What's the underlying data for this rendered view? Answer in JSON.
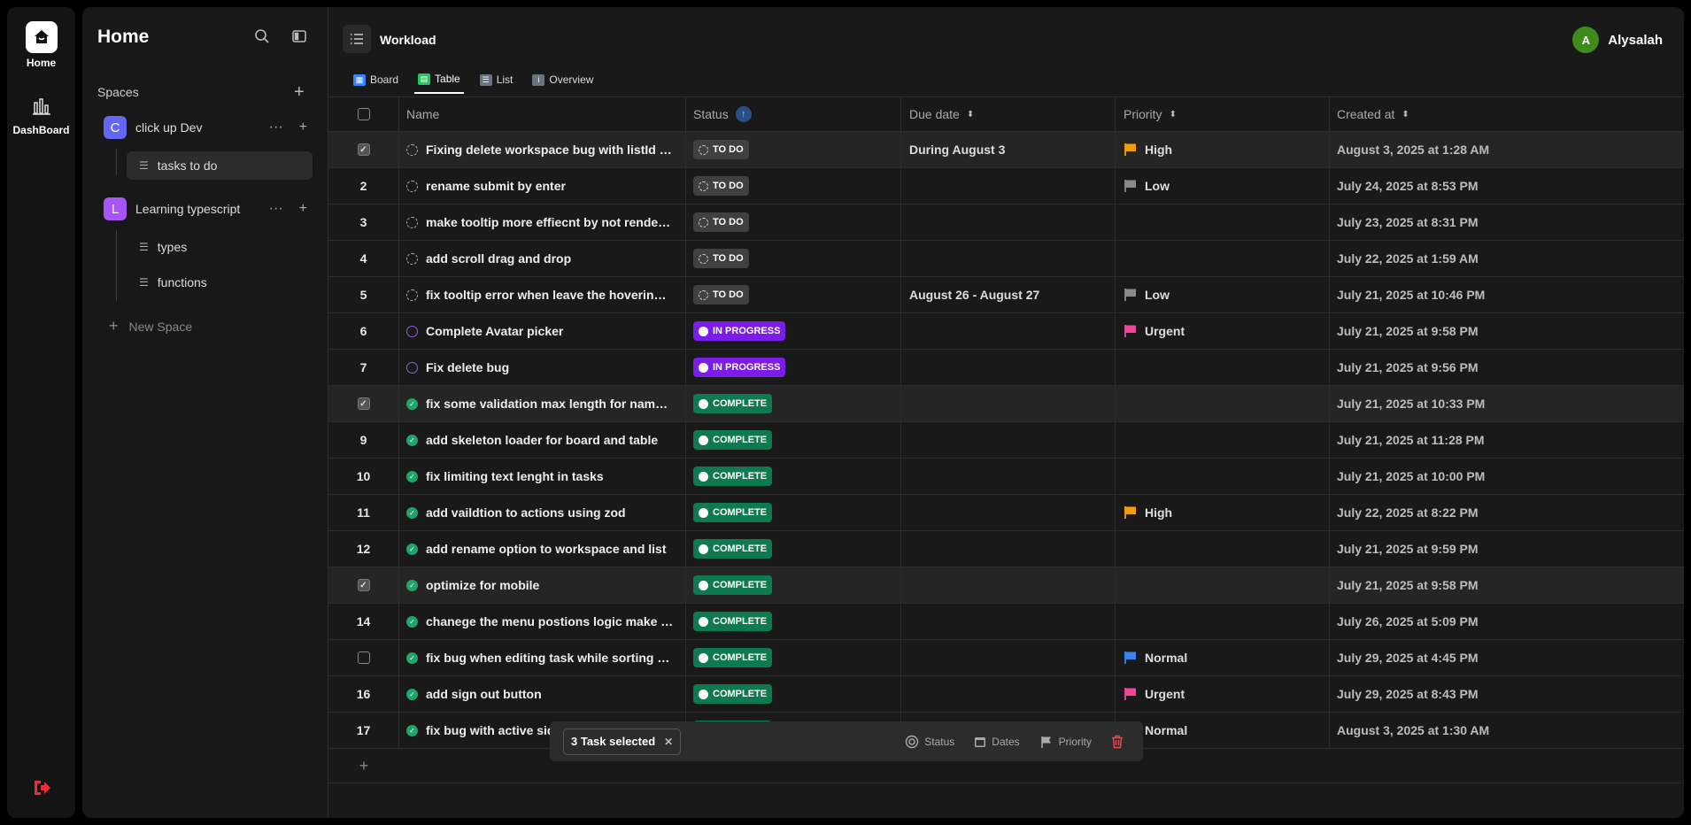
{
  "rail": {
    "home_label": "Home",
    "dashboard_label": "DashBoard"
  },
  "sidebar": {
    "title": "Home",
    "spaces_label": "Spaces",
    "new_space_label": "New Space",
    "spaces": [
      {
        "initial": "C",
        "name": "click up Dev",
        "color": "#6366f1",
        "lists": [
          "tasks to do"
        ]
      },
      {
        "initial": "L",
        "name": "Learning typescript",
        "color": "#a855f7",
        "lists": [
          "types",
          "functions"
        ]
      }
    ]
  },
  "header": {
    "workspace": "Workload",
    "user_initial": "A",
    "user_name": "Alysalah"
  },
  "tabs": [
    {
      "label": "Board",
      "color": "#3b82f6",
      "active": false
    },
    {
      "label": "Table",
      "color": "#22c55e",
      "active": true
    },
    {
      "label": "List",
      "color": "#6b7280",
      "active": false
    },
    {
      "label": "Overview",
      "color": "#6b7280",
      "active": false
    }
  ],
  "columns": [
    "Name",
    "Status",
    "Due date",
    "Priority",
    "Created at"
  ],
  "rows": [
    {
      "num": "",
      "checked": true,
      "name": "Fixing delete workspace bug with listId re...",
      "status": "TO DO",
      "due": "During August 3",
      "priority": "High",
      "created": "August 3, 2025 at 1:28 AM"
    },
    {
      "num": "2",
      "checked": false,
      "name": "rename submit by enter",
      "status": "TO DO",
      "due": "",
      "priority": "Low",
      "created": "July 24, 2025 at 8:53 PM"
    },
    {
      "num": "3",
      "checked": false,
      "name": "make tooltip more effiecnt by not render i...",
      "status": "TO DO",
      "due": "",
      "priority": "",
      "created": "July 23, 2025 at 8:31 PM"
    },
    {
      "num": "4",
      "checked": false,
      "name": "add scroll drag and drop",
      "status": "TO DO",
      "due": "",
      "priority": "",
      "created": "July 22, 2025 at 1:59 AM"
    },
    {
      "num": "5",
      "checked": false,
      "name": "fix tooltip error when leave the hovering s...",
      "status": "TO DO",
      "due": "August 26 - August 27",
      "priority": "Low",
      "created": "July 21, 2025 at 10:46 PM"
    },
    {
      "num": "6",
      "checked": false,
      "name": "Complete Avatar picker",
      "status": "IN PROGRESS",
      "due": "",
      "priority": "Urgent",
      "created": "July 21, 2025 at 9:58 PM"
    },
    {
      "num": "7",
      "checked": false,
      "name": "Fix delete bug",
      "status": "IN PROGRESS",
      "due": "",
      "priority": "",
      "created": "July 21, 2025 at 9:56 PM"
    },
    {
      "num": "",
      "checked": true,
      "name": "fix some validation max length for name b...",
      "status": "COMPLETE",
      "due": "",
      "priority": "",
      "created": "July 21, 2025 at 10:33 PM"
    },
    {
      "num": "9",
      "checked": false,
      "name": "add skeleton loader for board and table",
      "status": "COMPLETE",
      "due": "",
      "priority": "",
      "created": "July 21, 2025 at 11:28 PM"
    },
    {
      "num": "10",
      "checked": false,
      "name": "fix limiting text lenght in tasks",
      "status": "COMPLETE",
      "due": "",
      "priority": "",
      "created": "July 21, 2025 at 10:00 PM"
    },
    {
      "num": "11",
      "checked": false,
      "name": "add vaildtion to actions using zod",
      "status": "COMPLETE",
      "due": "",
      "priority": "High",
      "created": "July 22, 2025 at 8:22 PM"
    },
    {
      "num": "12",
      "checked": false,
      "name": "add rename option to workspace and list",
      "status": "COMPLETE",
      "due": "",
      "priority": "",
      "created": "July 21, 2025 at 9:59 PM"
    },
    {
      "num": "",
      "checked": true,
      "name": "optimize for mobile",
      "status": "COMPLETE",
      "due": "",
      "priority": "",
      "created": "July 21, 2025 at 9:58 PM"
    },
    {
      "num": "14",
      "checked": false,
      "name": "chanege the menu postions logic make it ...",
      "status": "COMPLETE",
      "due": "",
      "priority": "",
      "created": "July 26, 2025 at 5:09 PM"
    },
    {
      "num": "",
      "checked": false,
      "name": "fix bug when editing task while sorting wo...",
      "status": "COMPLETE",
      "due": "",
      "priority": "Normal",
      "created": "July 29, 2025 at 4:45 PM"
    },
    {
      "num": "16",
      "checked": false,
      "name": "add sign out button",
      "status": "COMPLETE",
      "due": "",
      "priority": "Urgent",
      "created": "July 29, 2025 at 8:43 PM"
    },
    {
      "num": "17",
      "checked": false,
      "name": "fix bug with active sid",
      "status": "COMPLETE",
      "due": "",
      "priority": "Normal",
      "created": "August 3, 2025 at 1:30 AM"
    }
  ],
  "priority_colors": {
    "High": "#f59e0b",
    "Low": "#8a8a8a",
    "Urgent": "#ec4899",
    "Normal": "#3b82f6"
  },
  "action_bar": {
    "selected": "3 Task selected",
    "status": "Status",
    "dates": "Dates",
    "priority": "Priority"
  }
}
